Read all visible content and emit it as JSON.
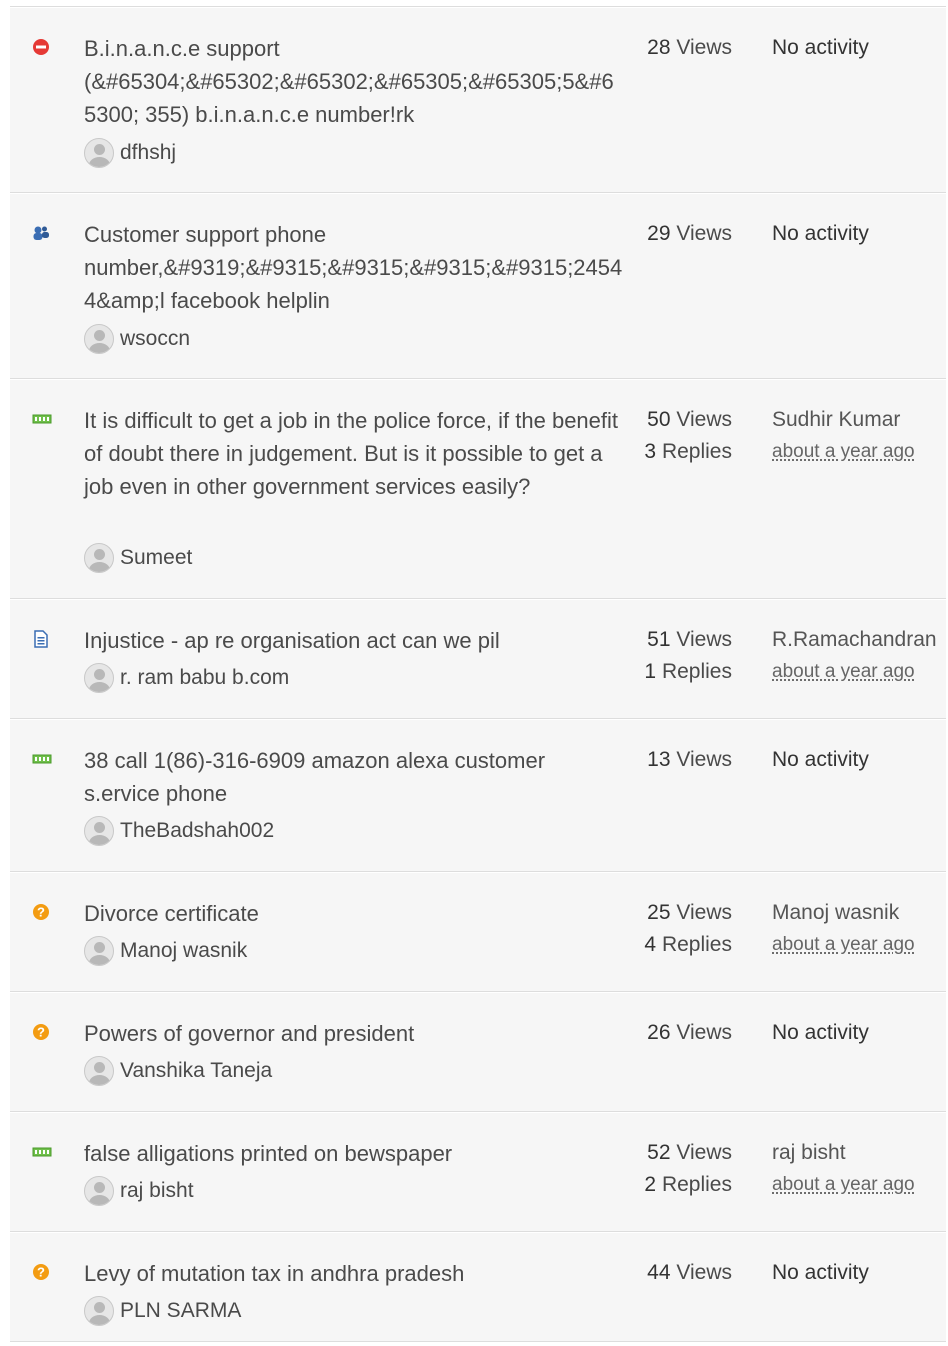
{
  "topics": [
    {
      "icon": "no-entry-icon",
      "title": "B.i.n.a.n.c.e support (&#65304;&#65302;&#65302;&#65305;&#65305;5&#65300; 355) b.i.n.a.n.c.e number!rk",
      "author": "dfhshj",
      "views": "28",
      "views_label": "Views",
      "replies": null,
      "replies_label": null,
      "activity_user": null,
      "activity_time": null,
      "no_activity": "No activity"
    },
    {
      "icon": "people-icon",
      "title": "Customer support phone number,&#9319;&#9315;&#9315;&#9315;&#9315;24544&amp;l facebook helplin",
      "author": "wsoccn",
      "views": "29",
      "views_label": "Views",
      "replies": null,
      "replies_label": null,
      "activity_user": null,
      "activity_time": null,
      "no_activity": "No activity"
    },
    {
      "icon": "new-badge-icon",
      "title": "It is difficult to get a job in the police force, if the benefit of doubt there in judgement. But is it possible to get a job even in other government services easily?",
      "author": "Sumeet",
      "views": "50",
      "views_label": "Views",
      "replies": "3",
      "replies_label": "Replies",
      "activity_user": "Sudhir Kumar",
      "activity_time": "about a year ago",
      "no_activity": null
    },
    {
      "icon": "document-icon",
      "title": "Injustice - ap re organisation act can we pil",
      "author": "r. ram babu b.com",
      "views": "51",
      "views_label": "Views",
      "replies": "1",
      "replies_label": "Replies",
      "activity_user": "R.Ramachandran",
      "activity_time": "about a year ago",
      "no_activity": null
    },
    {
      "icon": "new-badge-icon",
      "title": "38 call 1(86)-316-6909 amazon alexa customer s.ervice phone",
      "author": "TheBadshah002",
      "views": "13",
      "views_label": "Views",
      "replies": null,
      "replies_label": null,
      "activity_user": null,
      "activity_time": null,
      "no_activity": "No activity"
    },
    {
      "icon": "question-icon",
      "title": "Divorce certificate",
      "author": "Manoj wasnik",
      "views": "25",
      "views_label": "Views",
      "replies": "4",
      "replies_label": "Replies",
      "activity_user": "Manoj wasnik",
      "activity_time": "about a year ago",
      "no_activity": null
    },
    {
      "icon": "question-icon",
      "title": "Powers of governor and president",
      "author": "Vanshika Taneja",
      "views": "26",
      "views_label": "Views",
      "replies": null,
      "replies_label": null,
      "activity_user": null,
      "activity_time": null,
      "no_activity": "No activity"
    },
    {
      "icon": "new-badge-icon",
      "title": "false alligations printed on bewspaper",
      "author": "raj bisht",
      "views": "52",
      "views_label": "Views",
      "replies": "2",
      "replies_label": "Replies",
      "activity_user": "raj bisht",
      "activity_time": "about a year ago",
      "no_activity": null
    },
    {
      "icon": "question-icon",
      "title": "Levy of mutation tax in andhra pradesh",
      "author": "PLN SARMA",
      "views": "44",
      "views_label": "Views",
      "replies": null,
      "replies_label": null,
      "activity_user": null,
      "activity_time": null,
      "no_activity": "No activity"
    }
  ]
}
